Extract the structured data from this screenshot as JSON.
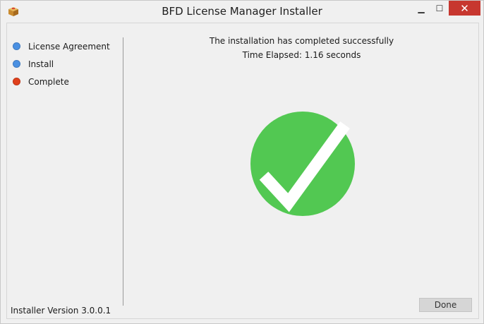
{
  "window": {
    "title": "BFD License Manager Installer",
    "minimize_glyph": "▁",
    "maximize_glyph": "☐",
    "close_glyph": "✕"
  },
  "steps": [
    {
      "label": "License Agreement",
      "state": "done",
      "color": "#4a90e2"
    },
    {
      "label": "Install",
      "state": "done",
      "color": "#4a90e2"
    },
    {
      "label": "Complete",
      "state": "current",
      "color": "#e0401c"
    }
  ],
  "status": {
    "line1": "The installation has completed successfully",
    "line2": "Time Elapsed: 1.16 seconds",
    "icon": "checkmark-success-icon",
    "icon_color": "#52c852"
  },
  "footer": {
    "version": "Installer Version 3.0.0.1",
    "done_label": "Done"
  }
}
